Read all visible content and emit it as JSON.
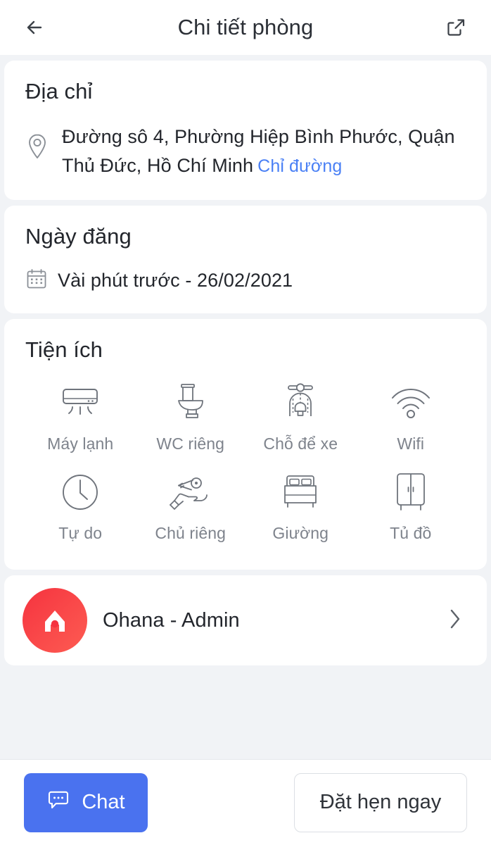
{
  "header": {
    "title": "Chi tiết phòng",
    "back_icon": "arrow-left-icon",
    "share_icon": "external-link-icon"
  },
  "address_section": {
    "title": "Địa chỉ",
    "icon": "location-pin-icon",
    "value": "Đường sô 4, Phường Hiệp Bình Phước, Quận Thủ Đức, Hồ Chí Minh",
    "link_label": "Chỉ đường",
    "link_color": "#4a80f5"
  },
  "date_section": {
    "title": "Ngày đăng",
    "icon": "calendar-icon",
    "value": "Vài phút trước - 26/02/2021"
  },
  "amenities_section": {
    "title": "Tiện ích",
    "items": [
      {
        "label": "Máy lạnh",
        "icon": "air-conditioner-icon"
      },
      {
        "label": "WC riêng",
        "icon": "toilet-icon"
      },
      {
        "label": "Chỗ để xe",
        "icon": "scooter-icon"
      },
      {
        "label": "Wifi",
        "icon": "wifi-icon"
      },
      {
        "label": "Tự do",
        "icon": "clock-icon"
      },
      {
        "label": "Chủ riêng",
        "icon": "hand-key-icon"
      },
      {
        "label": "Giường",
        "icon": "bed-icon"
      },
      {
        "label": "Tủ đồ",
        "icon": "wardrobe-icon"
      }
    ]
  },
  "owner_section": {
    "name": "Ohana - Admin",
    "avatar_icon": "ohana-house-logo",
    "avatar_color": "#f5333f",
    "chevron_icon": "chevron-right-icon"
  },
  "bottom_bar": {
    "chat_label": "Chat",
    "chat_icon": "chat-bubble-icon",
    "chat_color": "#4a72ef",
    "book_label": "Đặt hẹn ngay"
  }
}
